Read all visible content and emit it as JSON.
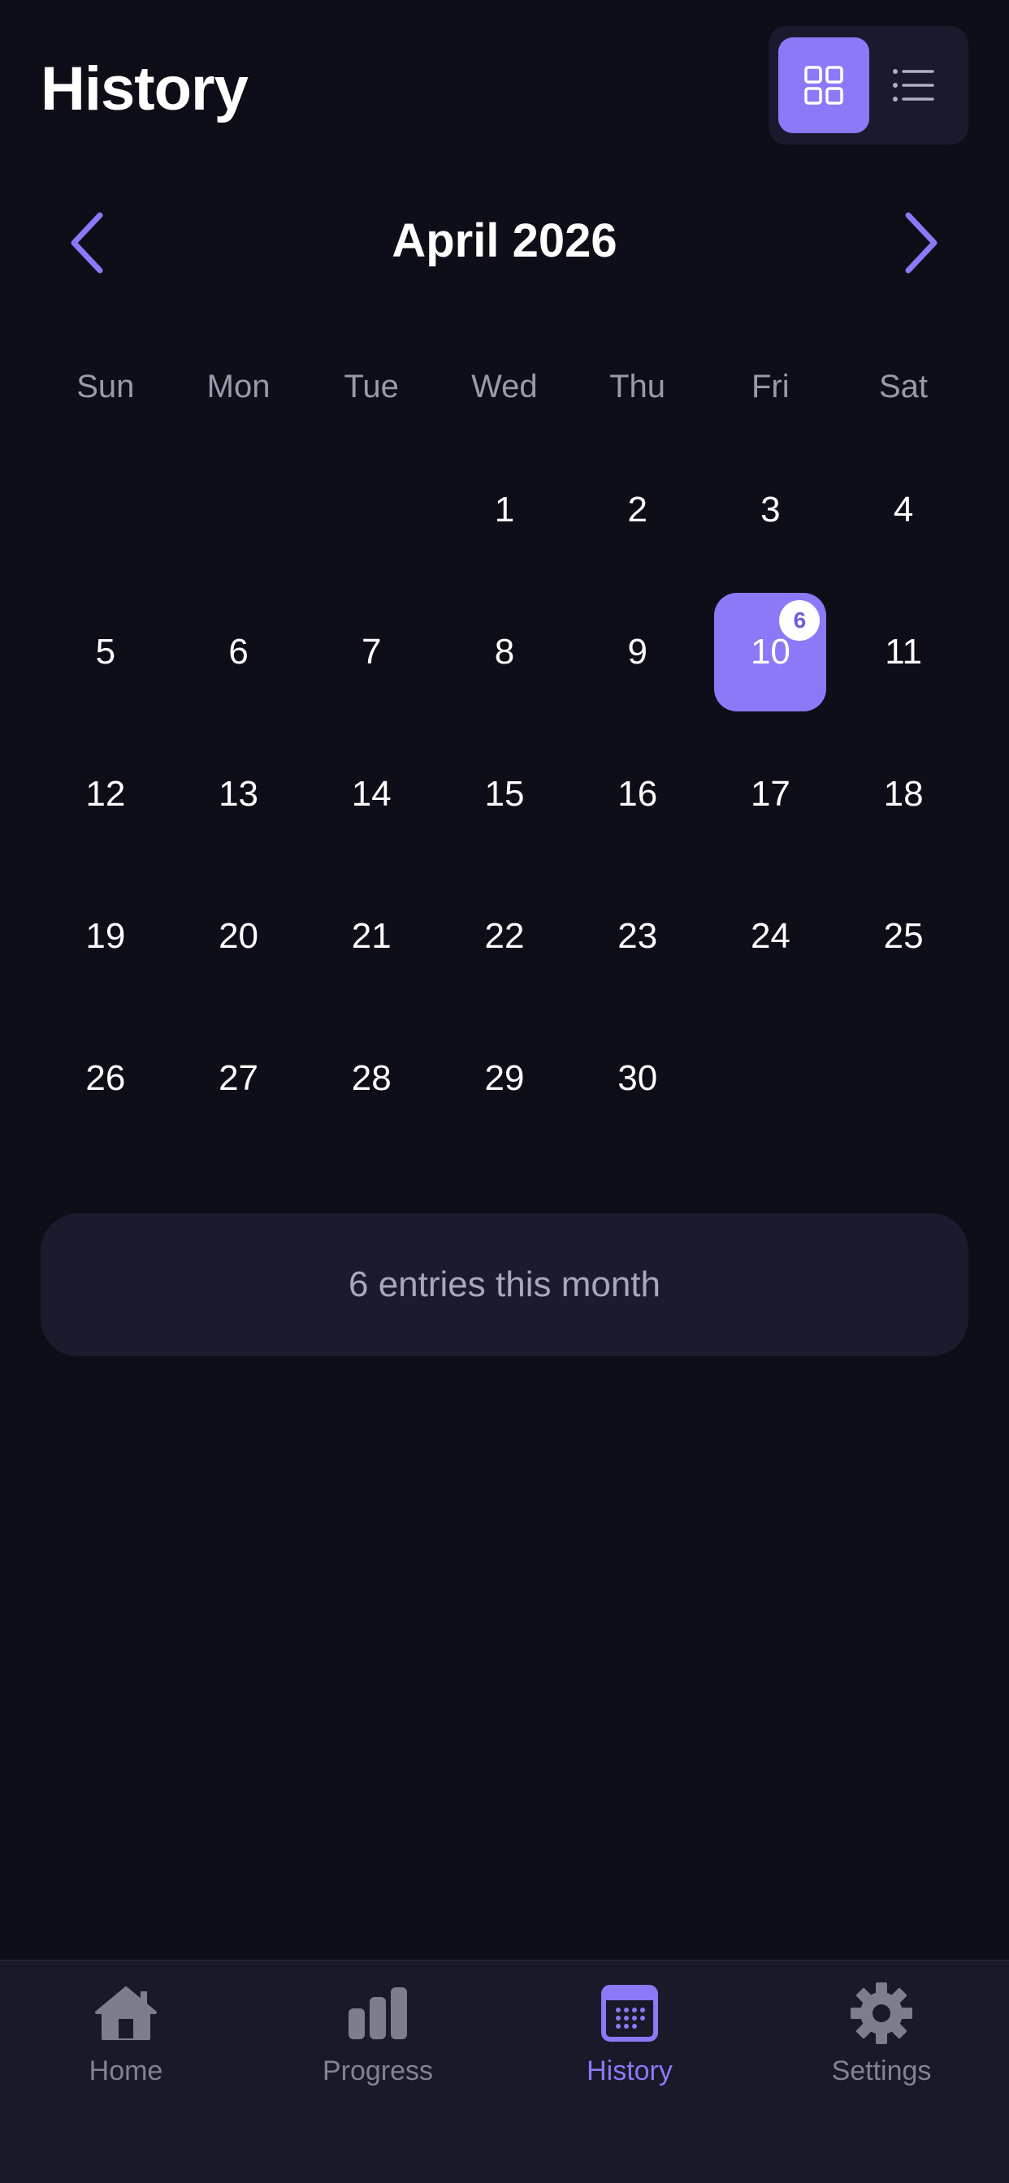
{
  "header": {
    "title": "History"
  },
  "view_toggle": {
    "active": "grid",
    "options": [
      "grid-view-icon",
      "list-view-icon"
    ]
  },
  "calendar": {
    "month_label": "April 2026",
    "weekdays": [
      "Sun",
      "Mon",
      "Tue",
      "Wed",
      "Thu",
      "Fri",
      "Sat"
    ],
    "first_weekday_index": 3,
    "days_in_month": 30,
    "selected_day": 10,
    "selected_day_count": "6"
  },
  "summary": {
    "text": "6 entries this month"
  },
  "bottom_nav": {
    "items": [
      {
        "label": "Home",
        "icon": "home-icon",
        "active": false
      },
      {
        "label": "Progress",
        "icon": "bar-chart-icon",
        "active": false
      },
      {
        "label": "History",
        "icon": "calendar-icon",
        "active": true
      },
      {
        "label": "Settings",
        "icon": "gear-icon",
        "active": false
      }
    ]
  },
  "colors": {
    "background": "#0e0e18",
    "accent": "#8b79f8",
    "surface": "#1b1b30",
    "muted_text": "#9a9aac"
  }
}
